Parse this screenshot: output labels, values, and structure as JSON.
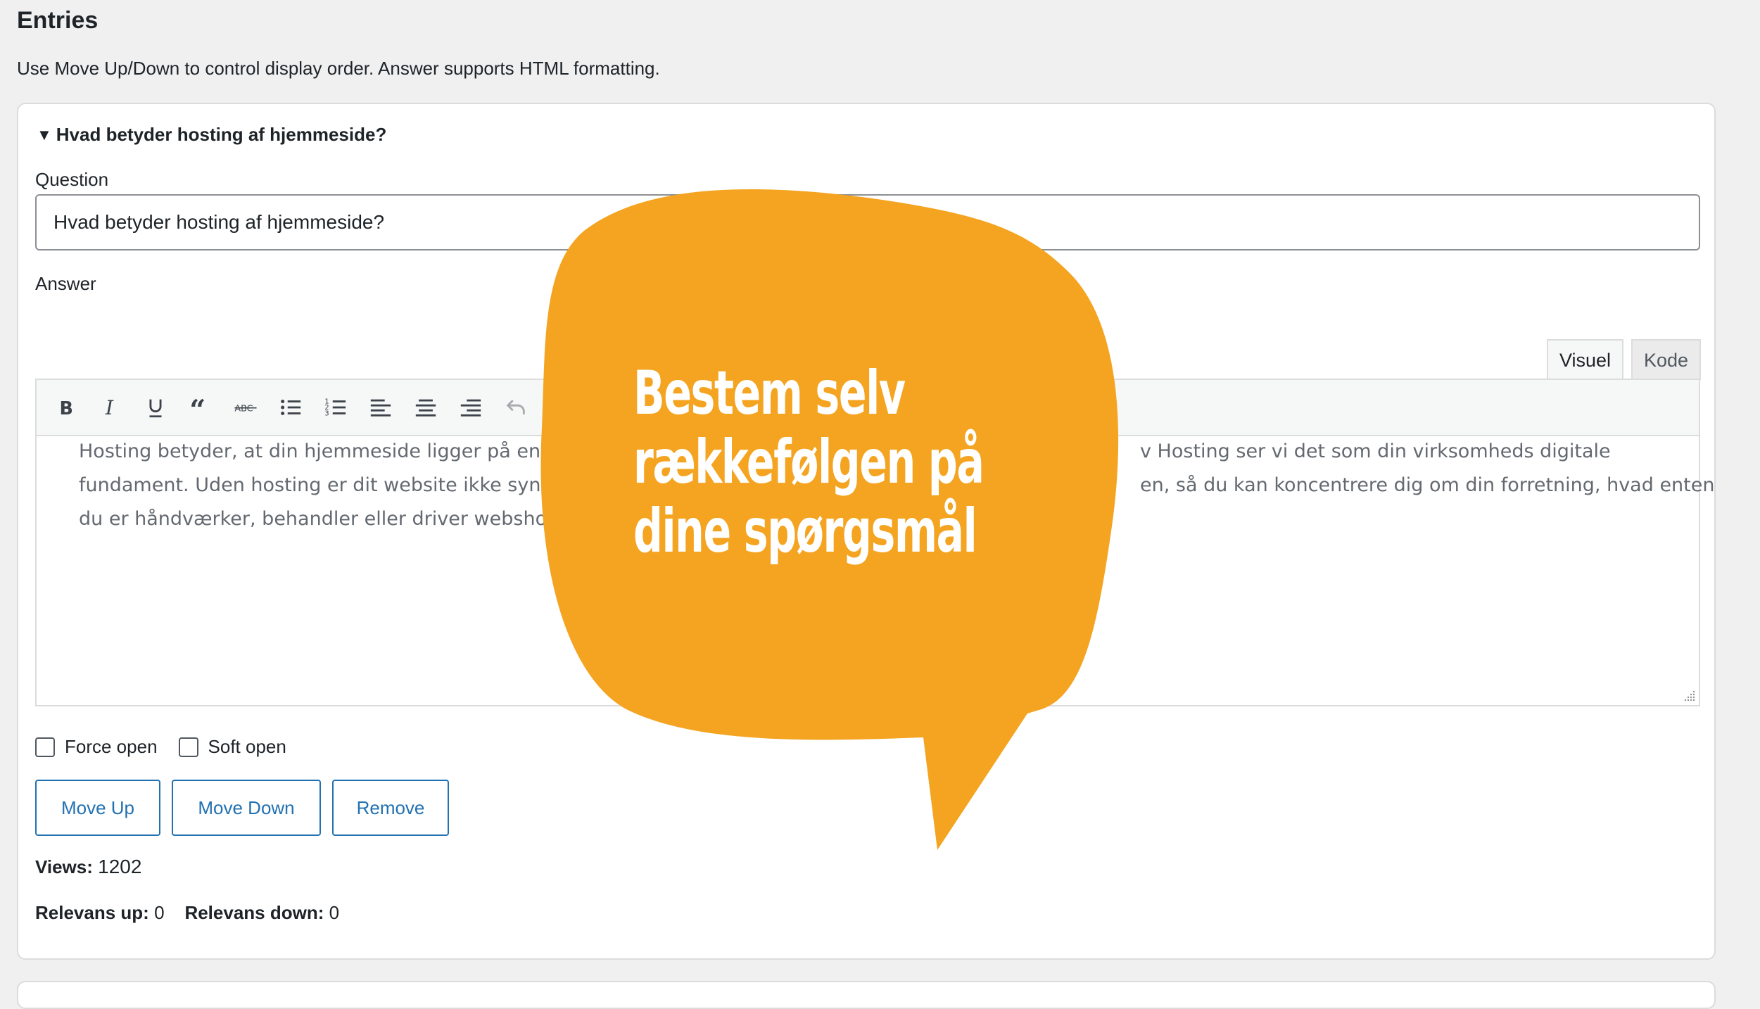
{
  "section": {
    "title": "Entries",
    "intro": "Use Move Up/Down to control display order. Answer supports HTML formatting."
  },
  "entry": {
    "summary": "Hvad betyder hosting af hjemmeside?",
    "question_label": "Question",
    "question_value": "Hvad betyder hosting af hjemmeside?",
    "answer_label": "Answer",
    "tabs": {
      "visual": "Visuel",
      "code": "Kode"
    },
    "toolbar_icons": [
      "bold-icon",
      "italic-icon",
      "underline-icon",
      "blockquote-icon",
      "strikethrough-icon",
      "bullet-list-icon",
      "numbered-list-icon",
      "align-left-icon",
      "align-center-icon",
      "align-right-icon",
      "undo-icon"
    ],
    "answer_text": "Hosting betyder, at din hjemmeside ligger på en se                                                                                                                           v Hosting ser vi det som din virksomheds digitale fundament. Uden hosting er dit website ikke synlig                                                                                                               en, så du kan koncentrere dig om din forretning, hvad enten du er håndværker, behandler eller driver webshop.",
    "answer_lines": [
      "Hosting betyder, at din hjemmeside ligger på en se",
      "fundament. Uden hosting er dit website ikke synlig",
      "du er håndværker, behandler eller driver webshop."
    ],
    "answer_lines_right": [
      "v Hosting ser vi det som din virksomheds digitale",
      "en, så du kan koncentrere dig om din forretning, hvad enten"
    ],
    "options": {
      "force_open": "Force open",
      "soft_open": "Soft open"
    },
    "buttons": {
      "move_up": "Move Up",
      "move_down": "Move Down",
      "remove": "Remove"
    },
    "stats": {
      "views_label": "Views:",
      "views_value": "1202",
      "relevans_up_label": "Relevans up:",
      "relevans_up_value": "0",
      "relevans_down_label": "Relevans down:",
      "relevans_down_value": "0"
    }
  },
  "callout": {
    "lines": [
      "Bestem selv",
      "rækkefølgen på",
      "dine spørgsmål"
    ],
    "color": "#f4a420"
  },
  "colors": {
    "button_accent": "#2271b1",
    "page_bg": "#f0f0f1"
  }
}
